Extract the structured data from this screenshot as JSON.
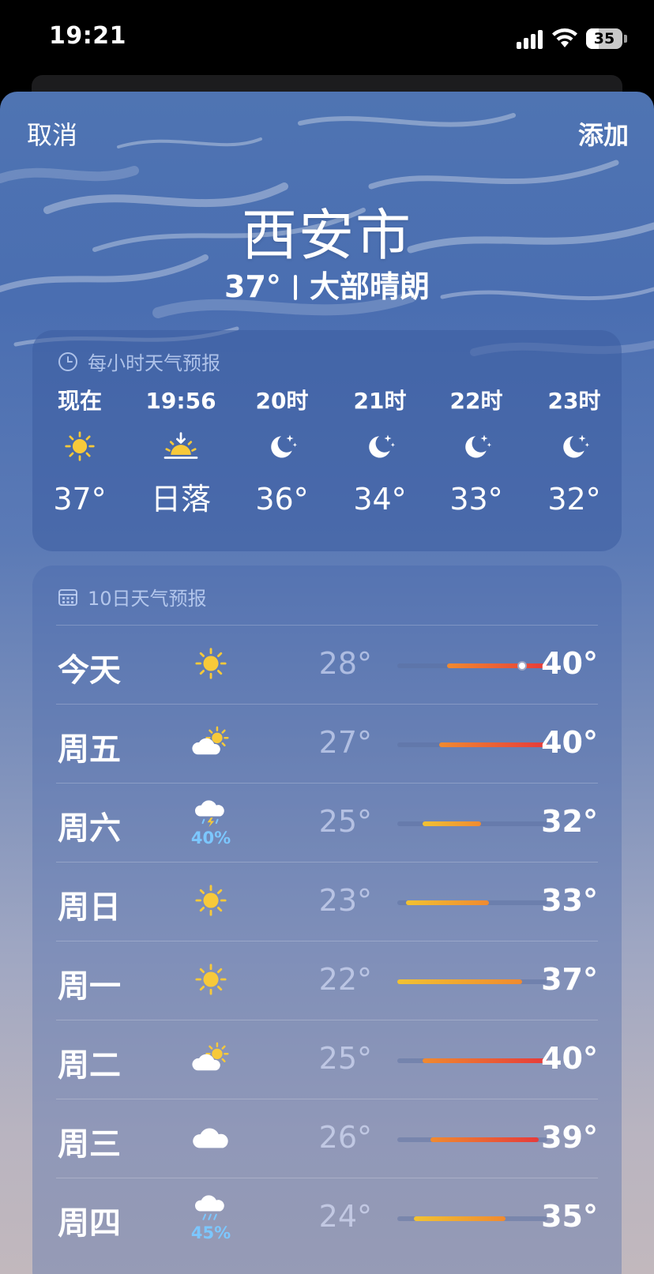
{
  "status_bar": {
    "time": "19:21",
    "battery": "35",
    "battery_level": 35
  },
  "nav": {
    "cancel": "取消",
    "add": "添加"
  },
  "location": {
    "city": "西安市",
    "current_temp": "37°",
    "condition": "大部晴朗"
  },
  "hourly": {
    "title": "每小时天气预报",
    "items": [
      {
        "label": "现在",
        "icon": "sun-icon",
        "value": "37°"
      },
      {
        "label": "19:56",
        "icon": "sunset-icon",
        "value": "日落"
      },
      {
        "label": "20时",
        "icon": "moon-stars-icon",
        "value": "36°"
      },
      {
        "label": "21时",
        "icon": "moon-stars-icon",
        "value": "34°"
      },
      {
        "label": "22时",
        "icon": "moon-stars-icon",
        "value": "33°"
      },
      {
        "label": "23时",
        "icon": "moon-stars-icon",
        "value": "32°"
      }
    ]
  },
  "daily": {
    "title": "10日天气预报",
    "range_min": 22,
    "range_max": 40,
    "items": [
      {
        "day": "今天",
        "icon": "sun-icon",
        "pop": "",
        "low": "28°",
        "high": "40°",
        "low_value": 28,
        "high_value": 40,
        "current_value": 37
      },
      {
        "day": "周五",
        "icon": "partly-cloudy-icon",
        "pop": "",
        "low": "27°",
        "high": "40°",
        "low_value": 27,
        "high_value": 40
      },
      {
        "day": "周六",
        "icon": "thunderstorm-icon",
        "pop": "40%",
        "low": "25°",
        "high": "32°",
        "low_value": 25,
        "high_value": 32
      },
      {
        "day": "周日",
        "icon": "sun-icon",
        "pop": "",
        "low": "23°",
        "high": "33°",
        "low_value": 23,
        "high_value": 33
      },
      {
        "day": "周一",
        "icon": "sun-icon",
        "pop": "",
        "low": "22°",
        "high": "37°",
        "low_value": 22,
        "high_value": 37
      },
      {
        "day": "周二",
        "icon": "partly-cloudy-icon",
        "pop": "",
        "low": "25°",
        "high": "40°",
        "low_value": 25,
        "high_value": 40
      },
      {
        "day": "周三",
        "icon": "cloud-icon",
        "pop": "",
        "low": "26°",
        "high": "39°",
        "low_value": 26,
        "high_value": 39
      },
      {
        "day": "周四",
        "icon": "rain-icon",
        "pop": "45%",
        "low": "24°",
        "high": "35°",
        "low_value": 24,
        "high_value": 35
      }
    ]
  },
  "colors": {
    "sun": "#f7c93a",
    "pop_blue": "#7cc7ff",
    "bar_cool": "#f1c232",
    "bar_warm": "#f08a30",
    "bar_hot": "#e63a3a"
  }
}
